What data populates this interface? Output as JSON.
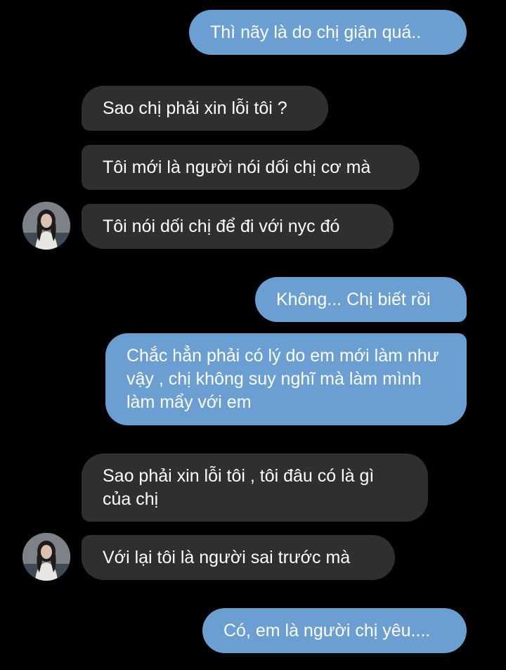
{
  "conversation": {
    "messages": [
      {
        "direction": "outgoing",
        "text": "Thì nãy là do chị giận quá.."
      },
      {
        "direction": "incoming",
        "text": "Sao chị phải xin lỗi tôi ?"
      },
      {
        "direction": "incoming",
        "text": "Tôi mới là người nói dối chị cơ mà"
      },
      {
        "direction": "incoming",
        "text": "Tôi nói dối chị để đi với nyc đó"
      },
      {
        "direction": "outgoing",
        "text": "Không... Chị biết rồi"
      },
      {
        "direction": "outgoing",
        "text": "Chắc hẳn phải có lý do em mới làm như vậy , chị không suy nghĩ mà làm mình làm mẩy với em"
      },
      {
        "direction": "incoming",
        "text": "Sao phải xin lỗi tôi , tôi đâu có là gì của chị"
      },
      {
        "direction": "incoming",
        "text": "Với lại tôi là người sai trước mà"
      },
      {
        "direction": "outgoing",
        "text": "Có, em là người chị yêu...."
      }
    ]
  },
  "colors": {
    "background": "#000000",
    "outgoing_bubble": "#6b9fd1",
    "incoming_bubble": "#2f2f2f",
    "text": "#ffffff"
  },
  "icons": {
    "avatar": "contact-avatar-photo"
  }
}
